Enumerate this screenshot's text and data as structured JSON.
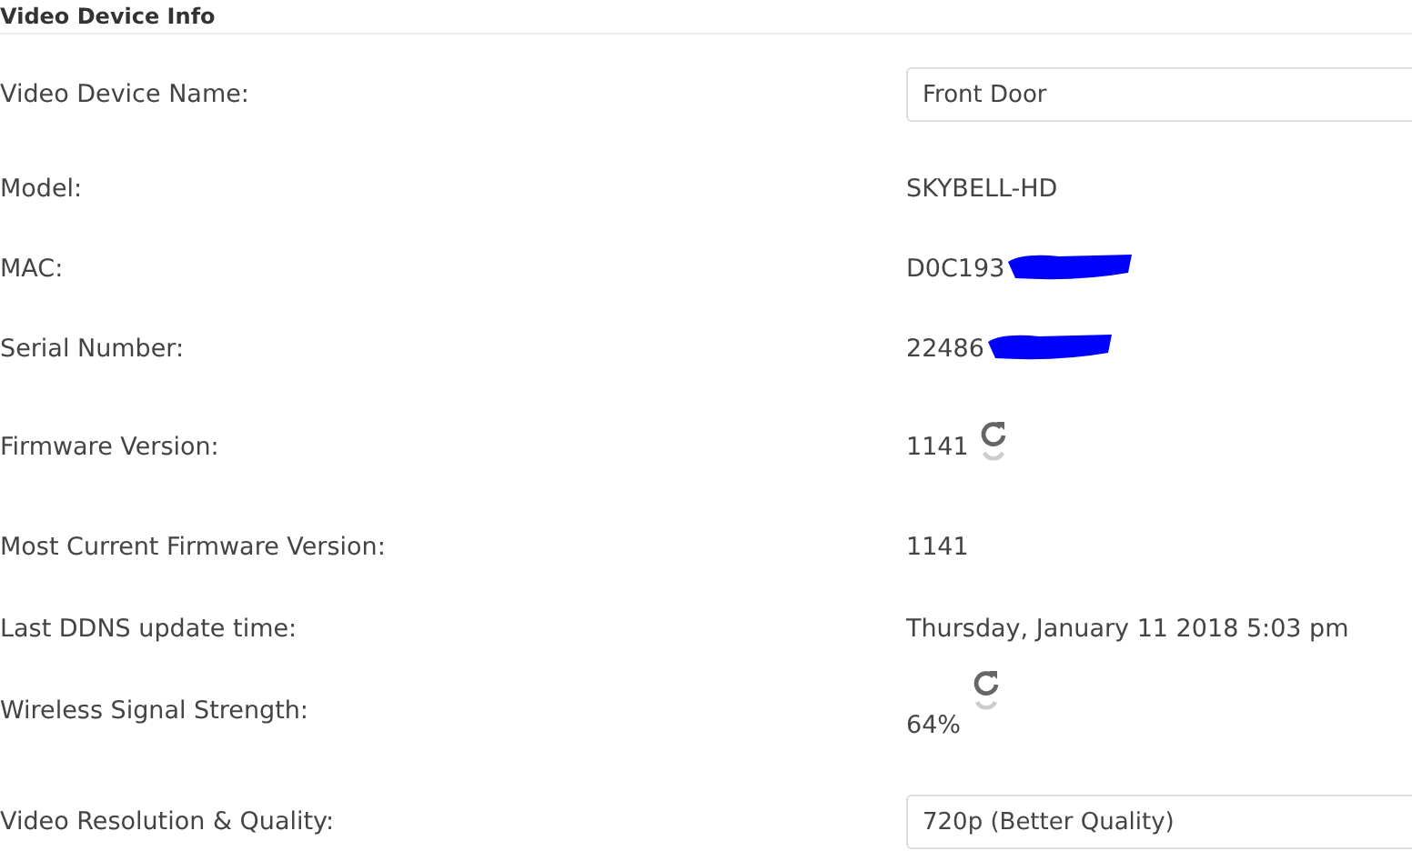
{
  "section": {
    "title": "Video Device Info"
  },
  "rows": [
    {
      "label": "Video Device Name:",
      "kind": "field",
      "value": "Front Door"
    },
    {
      "label": "Model:",
      "kind": "text",
      "value": "SKYBELL-HD"
    },
    {
      "label": "MAC:",
      "kind": "text",
      "value": "D0C193",
      "redacted": true
    },
    {
      "label": "Serial Number:",
      "kind": "text",
      "value": "22486",
      "redacted": true
    },
    {
      "label": "Firmware Version:",
      "kind": "refresh",
      "value": "1141"
    },
    {
      "label": "Most Current Firmware Version:",
      "kind": "text",
      "value": "1141"
    },
    {
      "label": "Last DDNS update time:",
      "kind": "text",
      "value": "Thursday, January 11 2018 5:03 pm"
    },
    {
      "label": "Wireless Signal Strength:",
      "kind": "refresh",
      "value": "64%"
    },
    {
      "label": "Video Resolution & Quality:",
      "kind": "field",
      "value": "720p (Better Quality)"
    }
  ]
}
